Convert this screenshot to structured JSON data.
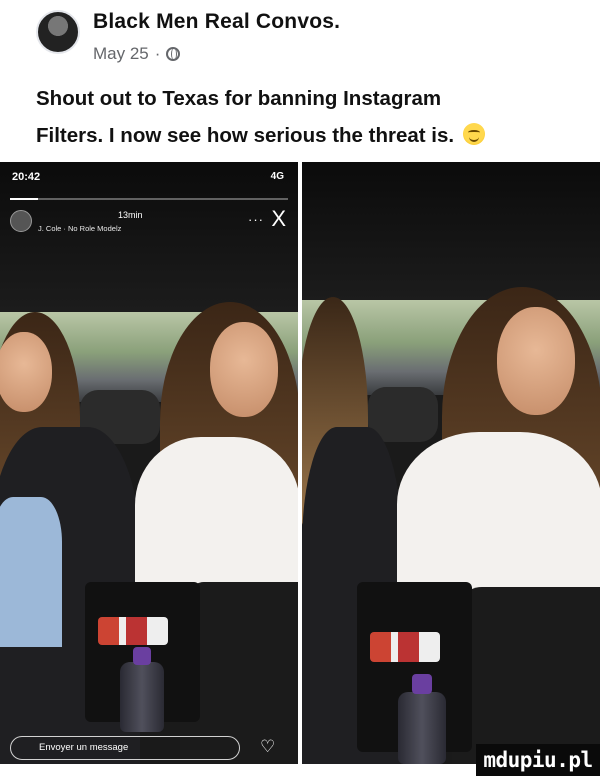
{
  "post": {
    "page_name": "Black Men Real Convos.",
    "date": "May 25",
    "separator": "·",
    "privacy_icon": "globe-icon",
    "caption_line1": "Shout out to Texas for banning Instagram",
    "caption_line2": "Filters.  I now see how serious the threat is.",
    "caption_emoji": "grinning-sweat-emoji"
  },
  "story": {
    "status_time": "20:42",
    "status_network": "4G",
    "progress_fraction": 0.1,
    "elapsed": "13min",
    "music": "J. Cole · No Role Modelz",
    "more_label": "···",
    "close_label": "X",
    "reply_placeholder": "Envoyer un message",
    "heart_icon": "♡"
  },
  "watermark": "mdupiu.pl"
}
